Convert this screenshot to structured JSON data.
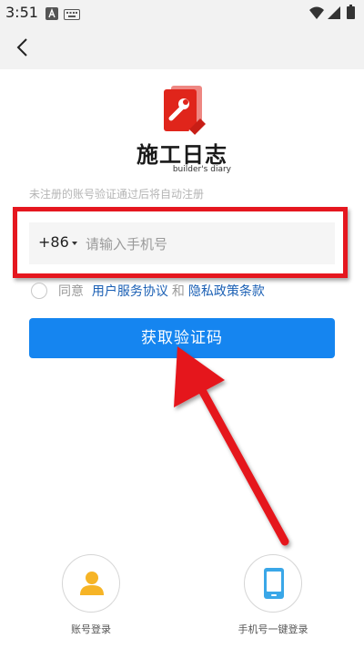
{
  "status_bar": {
    "time": "3:51",
    "icons": [
      "notification-a-icon",
      "keyboard-icon",
      "wifi-icon",
      "signal-icon",
      "battery-icon"
    ]
  },
  "nav": {
    "back_icon": "chevron-left-icon"
  },
  "logo": {
    "title": "施工日志",
    "subtitle": "builder's diary",
    "icon": "wrench-book-logo",
    "color": "#e0251b"
  },
  "form": {
    "hint": "未注册的账号验证通过后将自动注册",
    "country_code": "+86",
    "phone_placeholder": "请输入手机号",
    "phone_value": "",
    "agree_label": "同意",
    "user_agreement": "用户服务协议",
    "and": "和",
    "privacy_policy": "隐私政策条款",
    "submit_label": "获取验证码"
  },
  "login_options": [
    {
      "label": "账号登录",
      "icon": "user-icon"
    },
    {
      "label": "手机号一键登录",
      "icon": "phone-icon"
    }
  ],
  "colors": {
    "primary": "#1585f0",
    "link": "#1a5fb4",
    "annotation": "#e5171f",
    "icon_yellow": "#f6b426",
    "icon_blue": "#3aa7e8"
  }
}
